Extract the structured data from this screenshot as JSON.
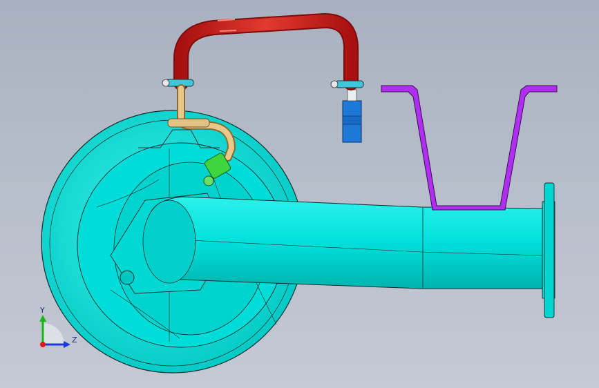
{
  "viewport": {
    "background_top": "#a9b0bf",
    "background_bottom": "#c4c9d4"
  },
  "model": {
    "colors": {
      "housing": "#00e5e0",
      "housing_shade": "#00b9b5",
      "edges": "#0b2b2b",
      "hose": "#c81e1e",
      "hose_highlight": "#ff6d5e",
      "bracket": "#a020e0",
      "block": "#1e78d8",
      "fitting": "#2ec02e",
      "tube": "#e0c07a"
    }
  },
  "triad": {
    "y_label": "Y",
    "z_label": "Z",
    "y_color": "#18b818",
    "z_color": "#1b3bd8",
    "x_color": "#e01818"
  }
}
